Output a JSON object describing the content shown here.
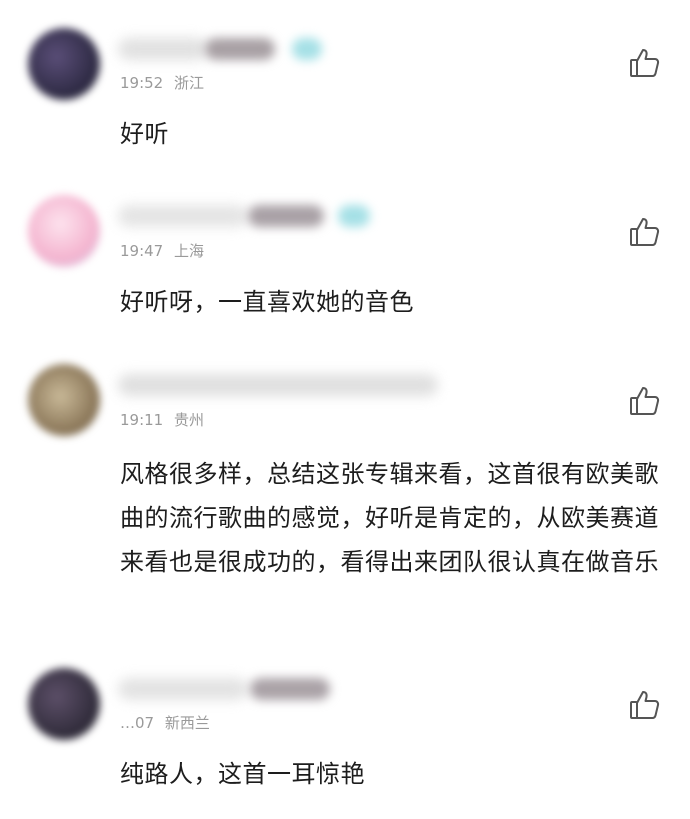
{
  "comments": [
    {
      "time": "19:52",
      "location": "浙江",
      "text": "好听",
      "avatar_color": "#3a3552"
    },
    {
      "time": "19:47",
      "location": "上海",
      "text": "好听呀，一直喜欢她的音色",
      "avatar_color": "#f2b6d0"
    },
    {
      "time": "19:11",
      "location": "贵州",
      "text": "风格很多样，总结这张专辑来看，这首很有欧美歌曲的流行歌曲的感觉，好听是肯定的，从欧美赛道来看也是很成功的，看得出来团队很认真在做音乐",
      "avatar_color": "#9a8a70"
    },
    {
      "time": "…07",
      "location": "新西兰",
      "text": "纯路人，这首一耳惊艳",
      "avatar_color": "#3b3447"
    }
  ],
  "icons": {
    "like": "thumbs-up-icon"
  }
}
